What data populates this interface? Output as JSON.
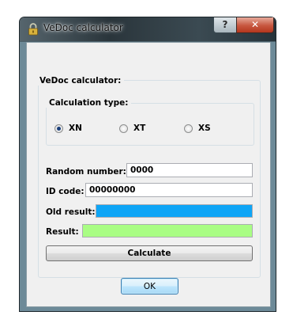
{
  "window": {
    "title": "VeDoc calculator",
    "title_icon": "padlock-icon",
    "help_label": "?",
    "close_label": "✕"
  },
  "group": {
    "label": "VeDoc calculator:",
    "calc_type": {
      "label": "Calculation type:",
      "options": [
        "XN",
        "XT",
        "XS"
      ],
      "selected": "XN"
    }
  },
  "fields": {
    "random_number": {
      "label": "Random number:",
      "value": "0000"
    },
    "id_code": {
      "label": "ID code:",
      "value": "00000000"
    },
    "old_result": {
      "label": "Old result:",
      "color": "#0ea5f6"
    },
    "result": {
      "label": "Result:",
      "color": "#a9fd84"
    }
  },
  "buttons": {
    "calculate": "Calculate",
    "ok": "OK"
  }
}
